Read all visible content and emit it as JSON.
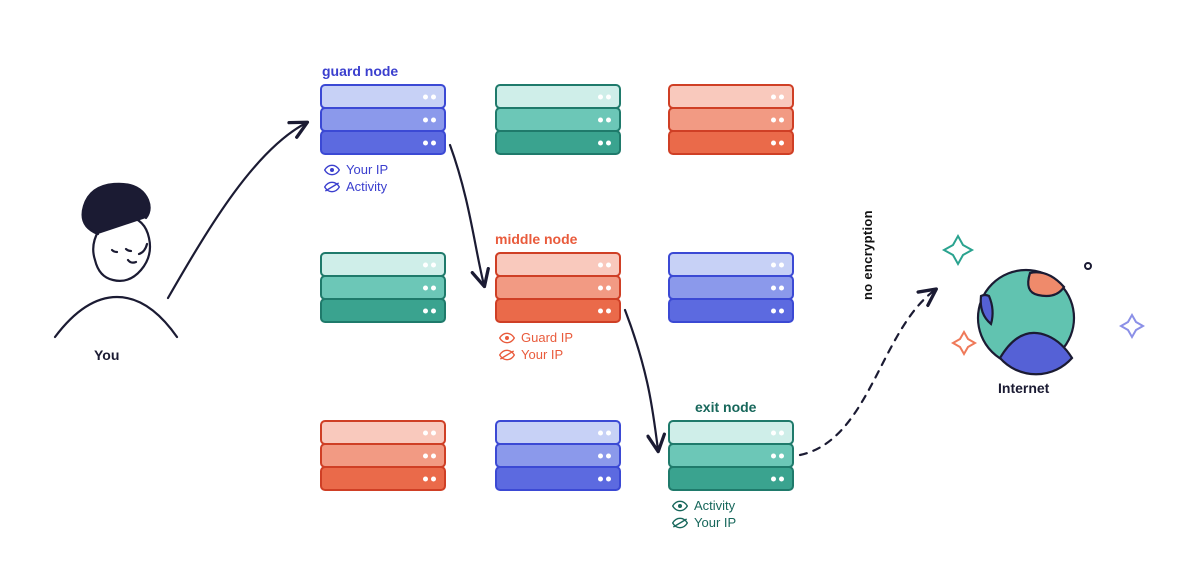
{
  "labels": {
    "you": "You",
    "internet": "Internet",
    "guard_node": "guard node",
    "middle_node": "middle node",
    "exit_node": "exit node",
    "no_encryption": "no encryption"
  },
  "nodes": {
    "guard": {
      "sees": "Your IP",
      "hidden": "Activity"
    },
    "middle": {
      "sees": "Guard IP",
      "hidden": "Your IP"
    },
    "exit": {
      "sees": "Activity",
      "hidden": "Your IP"
    }
  },
  "colors": {
    "blue": {
      "light": "#c7d1f6",
      "mid": "#8b99eb",
      "dark": "#5c6ae0",
      "stroke": "#3b49d4"
    },
    "teal": {
      "light": "#cfeee9",
      "mid": "#6cc7b7",
      "dark": "#3aa38f",
      "stroke": "#1f7a6b"
    },
    "orange": {
      "light": "#f9c9bd",
      "mid": "#f29a83",
      "dark": "#ea6a4a",
      "stroke": "#cf3f25"
    }
  },
  "grid": [
    [
      "blue",
      "teal",
      "orange"
    ],
    [
      "teal",
      "orange",
      "blue"
    ],
    [
      "orange",
      "blue",
      "teal"
    ]
  ],
  "path": {
    "description": "You → guard (top-left blue) → middle (center orange) → exit (bottom-right teal) → Internet",
    "final_leg_encrypted": false
  }
}
